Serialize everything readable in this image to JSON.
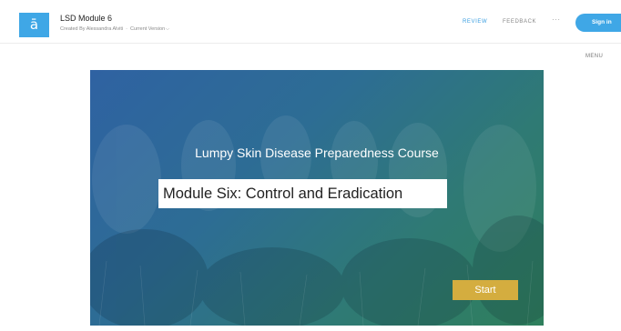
{
  "header": {
    "logo_glyph": "ā",
    "title": "LSD Module 6",
    "byline_author": "Created By Alessandra Alviti",
    "byline_separator": "·",
    "byline_version": "Current Version",
    "version_chevron_icon": "chevron-down-icon",
    "tabs": [
      {
        "label": "REVIEW",
        "active": true
      },
      {
        "label": "FEEDBACK",
        "active": false
      }
    ],
    "more_icon": "···",
    "signin_label": "Sign in"
  },
  "menu_label": "MENU",
  "slide": {
    "course_title": "Lumpy Skin Disease Preparedness Course",
    "module_title": "Module Six: Control and Eradication",
    "start_label": "Start",
    "background": "cows-in-field-photo"
  },
  "colors": {
    "accent": "#3fa7e6",
    "start_button": "#d4ad3f",
    "slide_gradient_start": "#2f62a2",
    "slide_gradient_end": "#2f7f5c"
  }
}
